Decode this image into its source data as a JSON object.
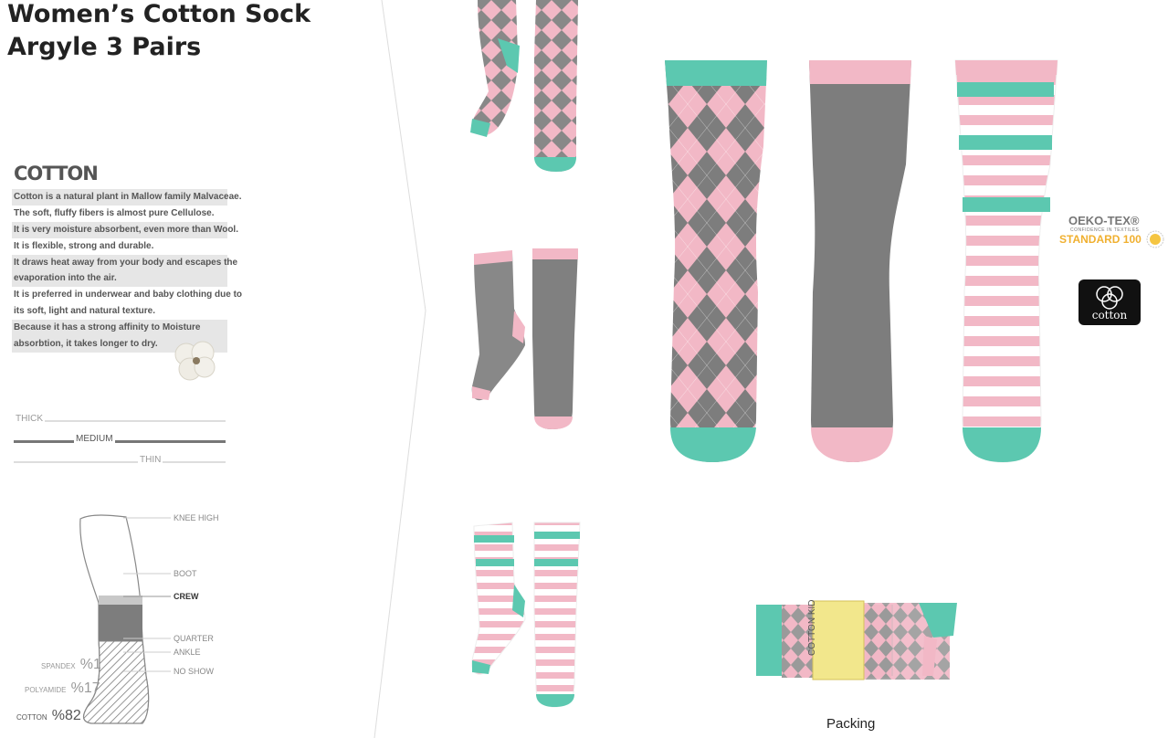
{
  "title": {
    "line1": "Women’s Cotton Sock",
    "line2": "Argyle 3 Pairs"
  },
  "cotton_info": {
    "heading": "COTTON",
    "lines": [
      "Cotton is a natural plant in Mallow family Malvaceae.",
      "The soft, fluffy fibers is almost pure Cellulose.",
      "It is very  moisture absorbent, even more than Wool.",
      "It is flexible, strong and durable.",
      "It draws heat away from your body and escapes the",
      "evaporation  into the air.",
      "It is preferred in underwear and baby clothing due to",
      "its soft, light and natural texture.",
      "Because  it has a strong affinity to Moisture",
      "absorbtion, it takes longer to dry."
    ]
  },
  "thickness": {
    "thick": "THICK",
    "medium": "MEDIUM",
    "thin": "THIN",
    "selected": "MEDIUM"
  },
  "leg_heights": {
    "knee_high": "KNEE HIGH",
    "boot": "BOOT",
    "crew": "CREW",
    "quarter": "QUARTER",
    "ankle": "ANKLE",
    "no_show": "NO SHOW",
    "selected": "CREW"
  },
  "materials": [
    {
      "name": "SPANDEX",
      "percent": "%1"
    },
    {
      "name": "POLYAMIDE",
      "percent": "%17"
    },
    {
      "name": "COTTON",
      "percent": "%82"
    }
  ],
  "certifications": {
    "oeko_line1": "OEKO-TEX®",
    "oeko_line2": "CONFIDENCE IN TEXTILES",
    "oeko_line3": "STANDARD 100",
    "cotton_logo": "cotton"
  },
  "packing": {
    "label": "Packing",
    "band_text": "COTTON KIDS"
  },
  "colors": {
    "pink": "#f2b8c6",
    "gray": "#808080",
    "mint": "#5cc8b0",
    "white": "#ffffff",
    "dark_gray": "#6e6e6e"
  }
}
